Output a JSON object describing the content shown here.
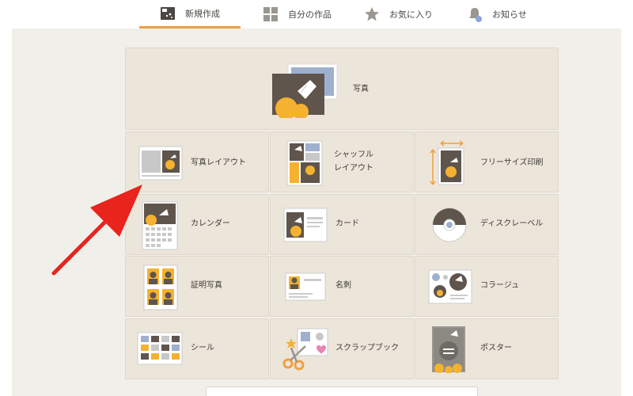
{
  "nav": {
    "tabs": [
      {
        "label": "新規作成",
        "icon": "new-create-icon",
        "active": true
      },
      {
        "label": "自分の作品",
        "icon": "grid-icon",
        "active": false
      },
      {
        "label": "お気に入り",
        "icon": "star-icon",
        "active": false
      },
      {
        "label": "お知らせ",
        "icon": "bell-icon",
        "active": false
      }
    ]
  },
  "menu": {
    "photo": "写真",
    "photo_layout": "写真レイアウト",
    "shuffle_layout_line1": "シャッフル",
    "shuffle_layout_line2": "レイアウト",
    "free_size": "フリーサイズ印刷",
    "calendar": "カレンダー",
    "card": "カード",
    "disc_label": "ディスクレーベル",
    "id_photo": "証明写真",
    "business_card": "名刺",
    "collage": "コラージュ",
    "sticker": "シール",
    "scrapbook": "スクラップブック",
    "poster": "ポスター"
  },
  "colors": {
    "accent": "#f0a040",
    "card_bg": "#ece5da",
    "content_bg": "#f1efea",
    "arrow": "#e8241c"
  }
}
